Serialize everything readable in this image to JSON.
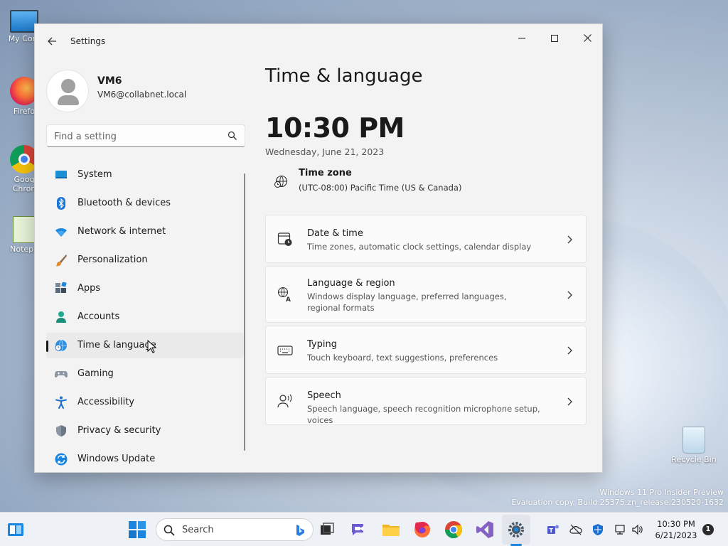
{
  "desktop": {
    "icons": [
      {
        "label": "My Com",
        "icon": "monitor-icon"
      },
      {
        "label": "Firefo",
        "icon": "firefox-icon"
      },
      {
        "label": "Goog",
        "label2": "Chron",
        "icon": "chrome-icon"
      },
      {
        "label": "Notepa",
        "icon": "notepad-icon"
      },
      {
        "label": "Recycle Bin",
        "icon": "recycle-bin-icon"
      }
    ],
    "watermark": {
      "line1": "Windows 11 Pro Insider Preview",
      "line2": "Evaluation copy. Build 25375.zn_release.230520-1632"
    }
  },
  "window": {
    "app_title": "Settings",
    "controls": {
      "minimize": "—",
      "maximize": "☐",
      "close": "✕"
    }
  },
  "profile": {
    "name": "VM6",
    "email": "VM6@collabnet.local"
  },
  "search": {
    "placeholder": "Find a setting"
  },
  "nav": {
    "items": [
      {
        "label": "System",
        "icon": "system-icon"
      },
      {
        "label": "Bluetooth & devices",
        "icon": "bluetooth-icon"
      },
      {
        "label": "Network & internet",
        "icon": "network-icon"
      },
      {
        "label": "Personalization",
        "icon": "brush-icon"
      },
      {
        "label": "Apps",
        "icon": "apps-icon"
      },
      {
        "label": "Accounts",
        "icon": "accounts-icon"
      },
      {
        "label": "Time & language",
        "icon": "globe-clock-icon",
        "active": true
      },
      {
        "label": "Gaming",
        "icon": "gamepad-icon"
      },
      {
        "label": "Accessibility",
        "icon": "accessibility-icon"
      },
      {
        "label": "Privacy & security",
        "icon": "shield-icon"
      },
      {
        "label": "Windows Update",
        "icon": "update-icon"
      }
    ]
  },
  "main": {
    "title": "Time & language",
    "clock": "10:30 PM",
    "date": "Wednesday, June 21, 2023",
    "timezone": {
      "title": "Time zone",
      "value": "(UTC-08:00) Pacific Time (US & Canada)"
    },
    "cards": [
      {
        "title": "Date & time",
        "subtitle": "Time zones, automatic clock settings, calendar display",
        "icon": "calendar-clock-icon"
      },
      {
        "title": "Language & region",
        "subtitle": "Windows display language, preferred languages, regional formats",
        "icon": "language-icon"
      },
      {
        "title": "Typing",
        "subtitle": "Touch keyboard, text suggestions, preferences",
        "icon": "keyboard-icon"
      },
      {
        "title": "Speech",
        "subtitle": "Speech language, speech recognition microphone setup, voices",
        "icon": "speech-icon"
      }
    ]
  },
  "taskbar": {
    "search_label": "Search",
    "time": "10:30 PM",
    "date": "6/21/2023",
    "notification_count": "1"
  },
  "colors": {
    "accent": "#0067c0",
    "window_bg": "#f3f3f3",
    "card_bg": "#fbfbfb"
  }
}
